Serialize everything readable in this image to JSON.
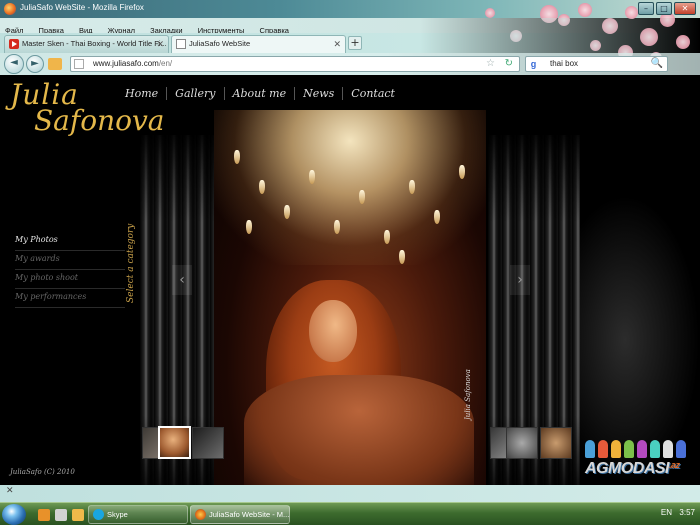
{
  "window": {
    "title": "JuliaSafo WebSite - Mozilla Firefox",
    "buttons": {
      "minimize": "–",
      "maximize": "□",
      "close": "✕"
    }
  },
  "menubar": {
    "items": [
      "Файл",
      "Правка",
      "Вид",
      "Журнал",
      "Закладки",
      "Инструменты",
      "Справка"
    ]
  },
  "tabs": [
    {
      "label": "Master Sken - Thai Boxing - World Title Fi...",
      "close": "✕",
      "icon": "youtube-icon"
    },
    {
      "label": "JuliaSafo WebSite",
      "close": "✕",
      "icon": "blank-page-icon"
    }
  ],
  "newtab_label": "+",
  "navbar": {
    "url_domain": "www.juliasafo.com",
    "url_path": "/en/",
    "search_engine": "g",
    "search_value": "thai box",
    "back": "◄",
    "forward": "►",
    "bookmark_star": "☆",
    "reload": "↻",
    "search_icon": "🔍"
  },
  "site": {
    "logo_line1": "Julia",
    "logo_line2": "Safonova",
    "nav": [
      "Home",
      "Gallery",
      "About me",
      "News",
      "Contact"
    ],
    "categories": [
      {
        "label": "My Photos",
        "active": true
      },
      {
        "label": "My awards",
        "active": false
      },
      {
        "label": "My photo shoot",
        "active": false
      },
      {
        "label": "My performances",
        "active": false
      }
    ],
    "select_category": "Select a category",
    "prev_arrow": "‹",
    "next_arrow": "›",
    "photo_signature": "Julia Safonova",
    "copyright": "JuliaSafo (C) 2010",
    "watermark_text": "AGMODASI",
    "watermark_suffix": ".az"
  },
  "statusbar": {
    "close": "✕"
  },
  "taskbar": {
    "tasks": [
      {
        "label": "Skype",
        "icon": "skype-icon"
      },
      {
        "label": "JuliaSafo WebSite - M...",
        "icon": "firefox-icon"
      }
    ],
    "tray": "EN",
    "clock": "3:57"
  }
}
